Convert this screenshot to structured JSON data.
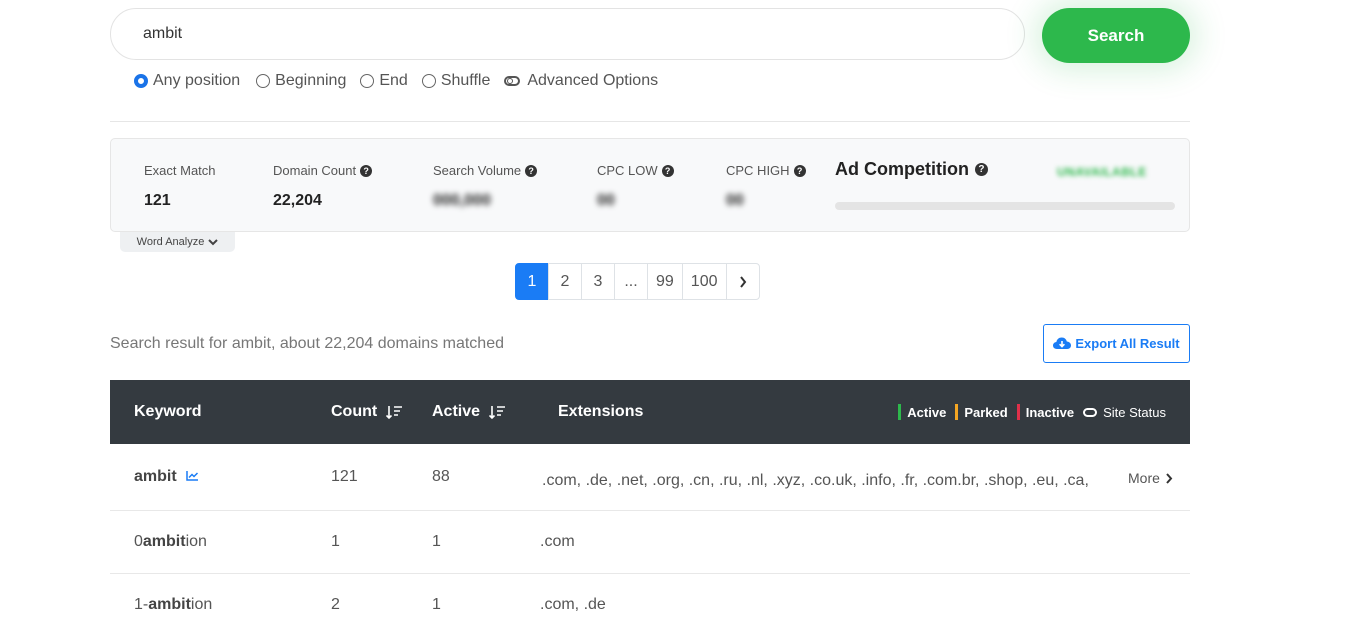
{
  "search": {
    "value": "ambit",
    "button_label": "Search"
  },
  "position_options": [
    {
      "label": "Any position",
      "checked": true
    },
    {
      "label": "Beginning",
      "checked": false
    },
    {
      "label": "End",
      "checked": false
    },
    {
      "label": "Shuffle",
      "checked": false
    }
  ],
  "advanced_options_label": "Advanced Options",
  "stats": {
    "exact_match": {
      "label": "Exact Match",
      "value": "121"
    },
    "domain_count": {
      "label": "Domain Count",
      "value": "22,204"
    },
    "search_volume": {
      "label": "Search Volume",
      "value": "000,000"
    },
    "cpc_low": {
      "label": "CPC LOW",
      "value": "00"
    },
    "cpc_high": {
      "label": "CPC HIGH",
      "value": "00"
    },
    "ad_competition": {
      "label": "Ad Competition",
      "status": "UNAVAILABLE"
    }
  },
  "word_analyze_label": "Word Analyze",
  "pagination": {
    "pages": [
      "1",
      "2",
      "3",
      "...",
      "99",
      "100"
    ],
    "active": "1"
  },
  "result_summary": "Search result for ambit, about 22,204 domains matched",
  "export_label": "Export All Result",
  "table": {
    "headers": {
      "keyword": "Keyword",
      "count": "Count",
      "active": "Active",
      "extensions": "Extensions"
    },
    "legend": {
      "active": "Active",
      "parked": "Parked",
      "inactive": "Inactive",
      "site_status": "Site Status"
    },
    "legend_colors": {
      "active": "#2db84c",
      "parked": "#f5a623",
      "inactive": "#e0304a"
    },
    "more_label": "More",
    "rows": [
      {
        "prefix": "",
        "bold": "ambit",
        "suffix": "",
        "count": "121",
        "active": "88",
        "extensions": ".com, .de, .net, .org, .cn, .ru, .nl, .xyz, .co.uk, .info, .fr, .com.br, .shop, .eu, .ca,"
      },
      {
        "prefix": "0",
        "bold": "ambit",
        "suffix": "ion",
        "count": "1",
        "active": "1",
        "extensions": ".com"
      },
      {
        "prefix": "1-",
        "bold": "ambit",
        "suffix": "ion",
        "count": "2",
        "active": "1",
        "extensions": ".com, .de"
      }
    ]
  }
}
